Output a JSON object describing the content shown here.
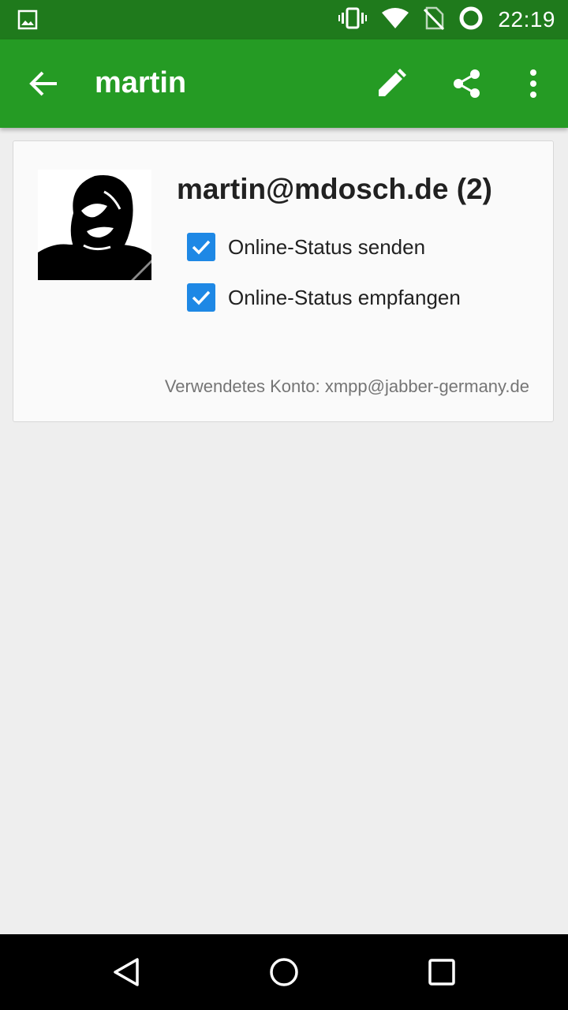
{
  "status_bar": {
    "time": "22:19",
    "icons": [
      "image-notification-icon",
      "vibrate-icon",
      "wifi-icon",
      "no-sim-icon",
      "battery-charging-icon"
    ]
  },
  "app_bar": {
    "title": "martin",
    "actions": [
      "back-arrow-icon",
      "edit-pencil-icon",
      "share-icon",
      "overflow-menu-icon"
    ]
  },
  "contact": {
    "jid": "martin@mdosch.de (2)",
    "options": [
      {
        "label": "Online-Status senden",
        "checked": true
      },
      {
        "label": "Online-Status empfangen",
        "checked": true
      }
    ],
    "account": "Verwendetes Konto: xmpp@jabber-germany.de"
  },
  "nav_bar": {
    "buttons": [
      "back-triangle-icon",
      "home-circle-icon",
      "recents-square-icon"
    ]
  },
  "colors": {
    "status_bar": "#1f7a1c",
    "app_bar": "#259b24",
    "checkbox": "#1e88e5",
    "background": "#eeeeee"
  }
}
